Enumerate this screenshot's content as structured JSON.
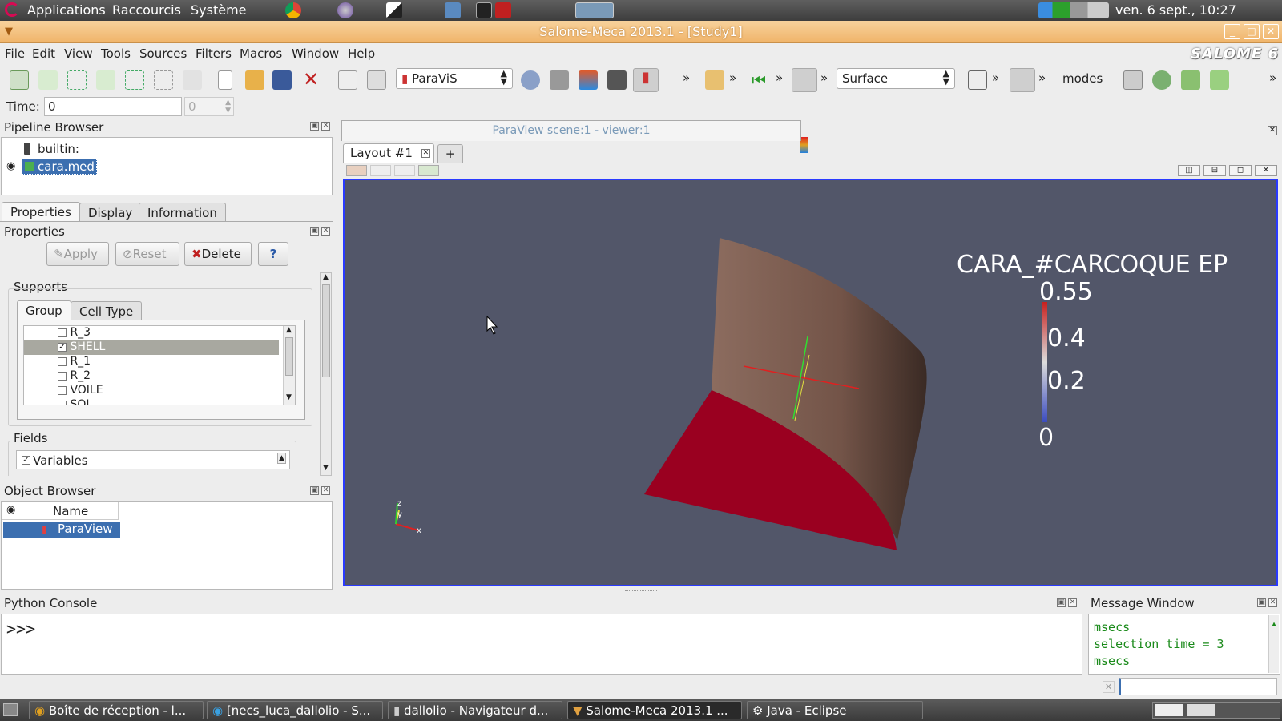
{
  "top_panel": {
    "menus": [
      "Applications",
      "Raccourcis",
      "Système"
    ],
    "clock": "ven.  6 sept., 10:27"
  },
  "window": {
    "title": "Salome-Meca 2013.1 - [Study1]",
    "brand": "SALOME 6"
  },
  "menubar": [
    "File",
    "Edit",
    "View",
    "Tools",
    "Sources",
    "Filters",
    "Macros",
    "Window",
    "Help"
  ],
  "toolbar": {
    "module_select": "ParaViS",
    "representation_select": "Surface",
    "modes_label": "modes",
    "overflow": "»"
  },
  "time_bar": {
    "label": "Time:",
    "value": "0",
    "spin_value": "0"
  },
  "pipeline_browser": {
    "title": "Pipeline Browser",
    "items": [
      "builtin:",
      "cara.med"
    ]
  },
  "property_tabs": [
    "Properties",
    "Display",
    "Information"
  ],
  "properties": {
    "title": "Properties",
    "apply_label": "Apply",
    "reset_label": "Reset",
    "delete_label": "Delete",
    "help_label": "?",
    "supports_label": "Supports",
    "support_tabs": [
      "Group",
      "Cell Type"
    ],
    "groups": [
      {
        "name": "R_3",
        "checked": false
      },
      {
        "name": "SHELL",
        "checked": true
      },
      {
        "name": "R_1",
        "checked": false
      },
      {
        "name": "R_2",
        "checked": false
      },
      {
        "name": "VOILE",
        "checked": false
      },
      {
        "name": "SOL",
        "checked": false
      }
    ],
    "fields_label": "Fields",
    "fields_item": "Variables"
  },
  "object_browser": {
    "title": "Object Browser",
    "column": "Name",
    "items": [
      "ParaView"
    ]
  },
  "viewer": {
    "title_tab": "ParaView scene:1 - viewer:1",
    "layout_tab": "Layout #1",
    "add_tab": "+",
    "legend": {
      "title": "CARA_#CARCOQUE EP",
      "ticks": [
        "0.55",
        "0.4",
        "0.2",
        "0"
      ]
    },
    "axes": {
      "x": "x",
      "y": "y",
      "z": "z"
    }
  },
  "python_console": {
    "title": "Python Console",
    "prompt": ">>>"
  },
  "message_window": {
    "title": "Message Window",
    "lines": [
      "msecs",
      "selection time = 3",
      "msecs"
    ]
  },
  "taskbar": {
    "tasks": [
      "Boîte de réception - l...",
      "[necs_luca_dallolio - S...",
      "dallolio - Navigateur d...",
      "Salome-Meca 2013.1 ...",
      "Java - Eclipse"
    ]
  },
  "colors": {
    "viewer_bg": "#525669",
    "title_bar": "#f0b46a",
    "selection": "#3c6fb0",
    "shell_surface": "#9a0020",
    "wall_surface": "#8a6a5e"
  }
}
